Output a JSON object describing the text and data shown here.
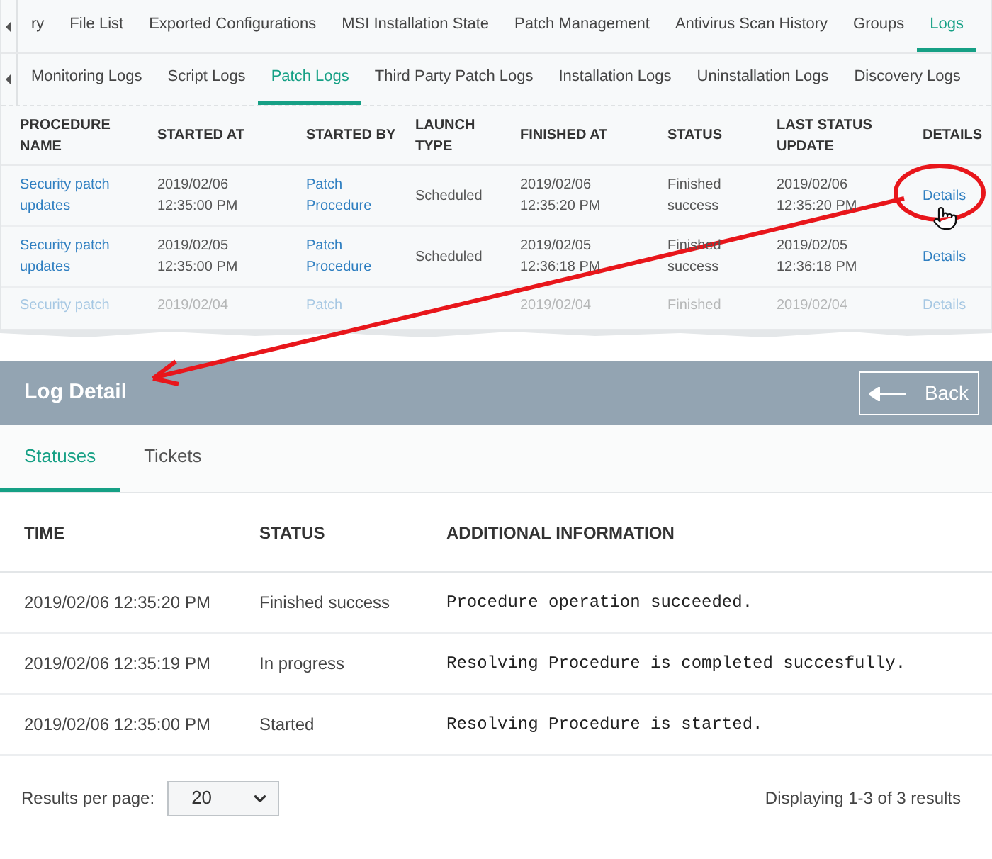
{
  "top_tabs": [
    {
      "label": "ry",
      "selected": false
    },
    {
      "label": "File List",
      "selected": false
    },
    {
      "label": "Exported Configurations",
      "selected": false
    },
    {
      "label": "MSI Installation State",
      "selected": false
    },
    {
      "label": "Patch Management",
      "selected": false
    },
    {
      "label": "Antivirus Scan History",
      "selected": false
    },
    {
      "label": "Groups",
      "selected": false
    },
    {
      "label": "Logs",
      "selected": true
    }
  ],
  "sub_tabs": [
    {
      "label": "Monitoring Logs",
      "selected": false
    },
    {
      "label": "Script Logs",
      "selected": false
    },
    {
      "label": "Patch Logs",
      "selected": true
    },
    {
      "label": "Third Party Patch Logs",
      "selected": false
    },
    {
      "label": "Installation Logs",
      "selected": false
    },
    {
      "label": "Uninstallation Logs",
      "selected": false
    },
    {
      "label": "Discovery Logs",
      "selected": false
    }
  ],
  "logs_table": {
    "columns": [
      "PROCEDURE NAME",
      "STARTED AT",
      "STARTED BY",
      "LAUNCH TYPE",
      "FINISHED AT",
      "STATUS",
      "LAST STATUS UPDATE",
      "DETAILS"
    ],
    "rows": [
      {
        "faded": false,
        "cells": [
          "Security patch updates",
          "2019/02/06 12:35:00 PM",
          "Patch Procedure",
          "Scheduled",
          "2019/02/06 12:35:20 PM",
          "Finished success",
          "2019/02/06 12:35:20 PM",
          "Details"
        ]
      },
      {
        "faded": false,
        "cells": [
          "Security patch updates",
          "2019/02/05 12:35:00 PM",
          "Patch Procedure",
          "Scheduled",
          "2019/02/05 12:36:18 PM",
          "Finished success",
          "2019/02/05 12:36:18 PM",
          "Details"
        ]
      },
      {
        "faded": true,
        "cells": [
          "Security patch",
          "2019/02/04",
          "Patch",
          "",
          "2019/02/04",
          "Finished",
          "2019/02/04",
          "Details"
        ]
      }
    ]
  },
  "log_detail": {
    "title": "Log Detail",
    "back_button": "Back",
    "tabs": [
      {
        "label": "Statuses",
        "selected": true
      },
      {
        "label": "Tickets",
        "selected": false
      }
    ],
    "columns": [
      "TIME",
      "STATUS",
      "ADDITIONAL INFORMATION"
    ],
    "rows": [
      [
        "2019/02/06 12:35:20 PM",
        "Finished success",
        "Procedure operation succeeded."
      ],
      [
        "2019/02/06 12:35:19 PM",
        "In progress",
        "Resolving Procedure is completed succesfully."
      ],
      [
        "2019/02/06 12:35:00 PM",
        "Started",
        "Resolving Procedure is started."
      ]
    ],
    "results_per_page_label": "Results per page:",
    "results_per_page": "20",
    "summary": "Displaying 1-3 of 3 results"
  }
}
